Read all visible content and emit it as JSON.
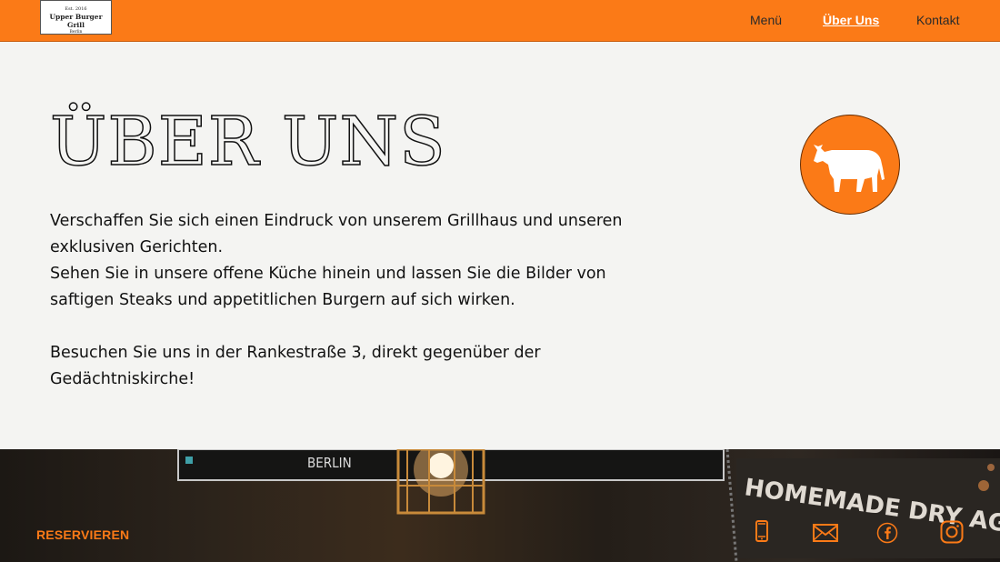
{
  "header": {
    "logo": {
      "est": "Est. 2016",
      "name": "Upper Burger Grill",
      "city": "Berlin"
    },
    "nav": [
      {
        "label": "Menü",
        "active": false
      },
      {
        "label": "Über Uns",
        "active": true
      },
      {
        "label": "Kontakt",
        "active": false
      }
    ]
  },
  "main": {
    "title": "ÜBER UNS",
    "paragraphs": [
      "Verschaffen Sie sich einen Eindruck von unserem Grillhaus und unseren exklusiven Gerichten.",
      "Sehen Sie in unsere offene Küche hinein und lassen Sie die Bilder von saftigen Steaks und appetitlichen Burgern auf sich wirken.",
      "Besuchen Sie uns in der Rankestraße 3, direkt gegenüber der Gedächtniskirche!"
    ],
    "badge_icon": "bull-icon"
  },
  "footer": {
    "reserve_label": "RESERVIEREN",
    "icons": [
      "phone-icon",
      "mail-icon",
      "facebook-icon",
      "instagram-icon"
    ]
  },
  "colors": {
    "accent": "#fb7a17",
    "background": "#f4f4f2",
    "text": "#111111"
  }
}
